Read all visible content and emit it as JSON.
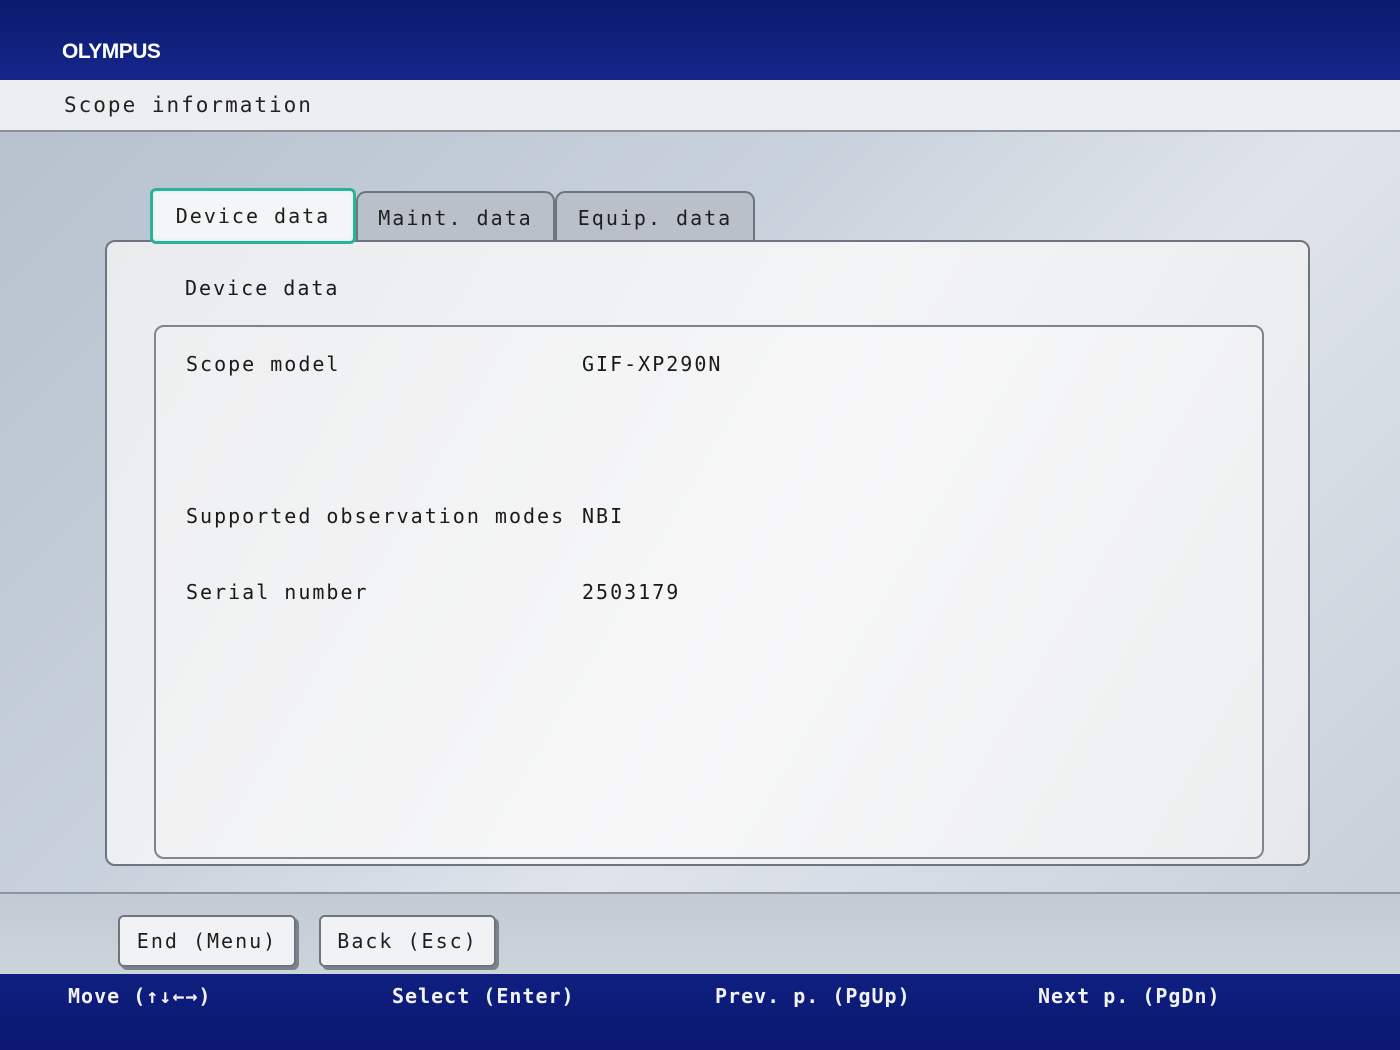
{
  "header": {
    "brand": "OLYMPUS",
    "title": "Scope information"
  },
  "tabs": [
    {
      "label": "Device data",
      "active": true
    },
    {
      "label": "Maint. data",
      "active": false
    },
    {
      "label": "Equip. data",
      "active": false
    }
  ],
  "panel": {
    "section_title": "Device data",
    "rows": [
      {
        "label": "Scope model",
        "value": "GIF-XP290N"
      },
      {
        "label": "Supported observation modes",
        "value": "NBI"
      },
      {
        "label": "Serial number",
        "value": "2503179"
      }
    ]
  },
  "buttons": {
    "end": "End (Menu)",
    "back": "Back (Esc)"
  },
  "footer": {
    "move": "Move (↑↓←→)",
    "select": "Select (Enter)",
    "prev": "Prev. p. (PgUp)",
    "next": "Next p. (PgDn)"
  },
  "colors": {
    "header_blue": "#0a1a6e",
    "active_tab_border": "#2bb39a"
  }
}
